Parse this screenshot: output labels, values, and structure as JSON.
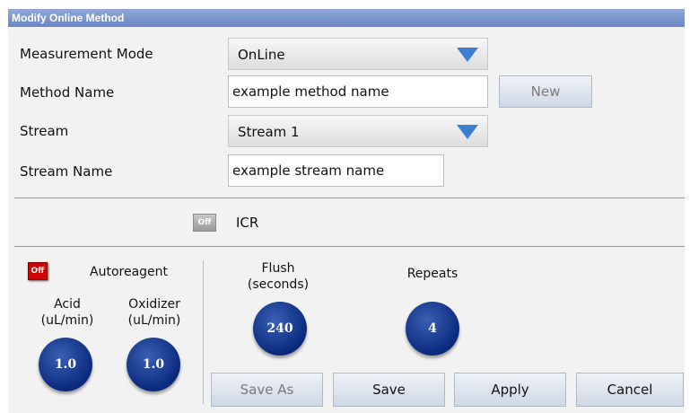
{
  "window": {
    "title": "Modify Online Method"
  },
  "form": {
    "measurement_mode_label": "Measurement Mode",
    "measurement_mode_value": "OnLine",
    "method_name_label": "Method Name",
    "method_name_value": "example method name",
    "new_button": "New",
    "stream_label": "Stream",
    "stream_value": "Stream 1",
    "stream_name_label": "Stream Name",
    "stream_name_value": "example stream name"
  },
  "icr": {
    "toggle_text": "Off",
    "label": "ICR"
  },
  "autoreagent": {
    "toggle_text": "Off",
    "label": "Autoreagent",
    "acid_label_1": "Acid",
    "acid_label_2": "(uL/min)",
    "acid_value": "1.0",
    "oxidizer_label_1": "Oxidizer",
    "oxidizer_label_2": "(uL/min)",
    "oxidizer_value": "1.0"
  },
  "flush": {
    "label_1": "Flush",
    "label_2": "(seconds)",
    "value": "240"
  },
  "repeats": {
    "label": "Repeats",
    "value": "4"
  },
  "buttons": {
    "save_as": "Save As",
    "save": "Save",
    "apply": "Apply",
    "cancel": "Cancel"
  },
  "colors": {
    "title_bar": "#7b94cc",
    "dial": "#0b2a7d",
    "toggle_off": "#d20000",
    "arrow": "#3b7fd2"
  }
}
